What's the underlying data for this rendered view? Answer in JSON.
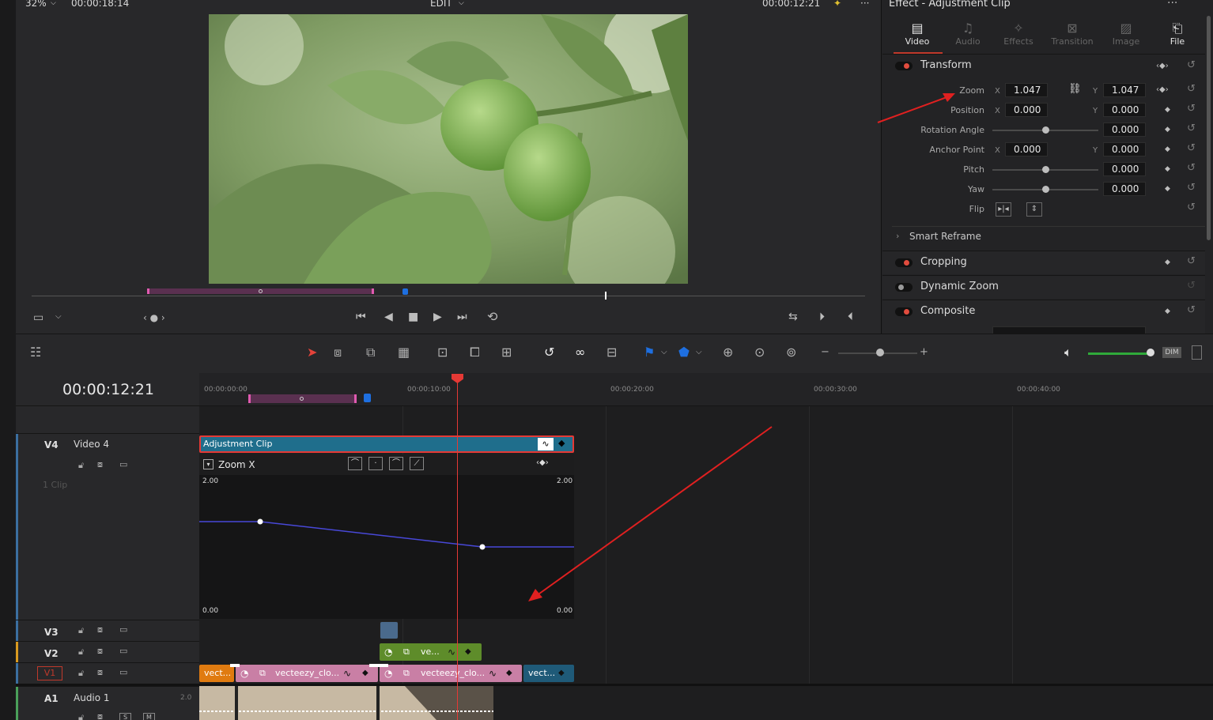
{
  "viewer": {
    "zoom": "32%",
    "source_timecode": "00:00:18:14",
    "mode": "EDIT",
    "record_timecode": "00:00:12:21"
  },
  "inspector": {
    "title": "Effect - Adjustment Clip",
    "tabs": [
      {
        "label": "Video",
        "icon": "film-icon",
        "active": true
      },
      {
        "label": "Audio",
        "icon": "music-note-icon",
        "active": false
      },
      {
        "label": "Effects",
        "icon": "magic-wand-icon",
        "active": false
      },
      {
        "label": "Transition",
        "icon": "transition-icon",
        "active": false
      },
      {
        "label": "Image",
        "icon": "image-icon",
        "active": false
      },
      {
        "label": "File",
        "icon": "file-icon",
        "active": false
      }
    ],
    "transform": {
      "label": "Transform",
      "zoom": {
        "label": "Zoom",
        "x_axis": "X",
        "y_axis": "Y",
        "x": "1.047",
        "y": "1.047"
      },
      "position": {
        "label": "Position",
        "x": "0.000",
        "y": "0.000"
      },
      "rotation": {
        "label": "Rotation Angle",
        "value": "0.000"
      },
      "anchor": {
        "label": "Anchor Point",
        "x": "0.000",
        "y": "0.000"
      },
      "pitch": {
        "label": "Pitch",
        "value": "0.000"
      },
      "yaw": {
        "label": "Yaw",
        "value": "0.000"
      },
      "flip": {
        "label": "Flip"
      }
    },
    "smart_reframe": "Smart Reframe",
    "cropping": "Cropping",
    "dynamic_zoom": "Dynamic Zoom",
    "composite": "Composite"
  },
  "timeline": {
    "timecode": "00:00:12:21",
    "ruler": [
      "00:00:00:00",
      "00:00:10:00",
      "00:00:20:00",
      "00:00:30:00",
      "00:00:40:00"
    ],
    "tracks": {
      "v4": {
        "id": "V4",
        "name": "Video 4",
        "clip_count": "1 Clip"
      },
      "v3": {
        "id": "V3"
      },
      "v2": {
        "id": "V2"
      },
      "v1": {
        "id": "V1"
      },
      "a1": {
        "id": "A1",
        "name": "Audio 1",
        "channels": "2.0",
        "s": "S",
        "m": "M"
      }
    },
    "adjustment_clip": "Adjustment Clip",
    "curve": {
      "label": "Zoom X",
      "max_left": "2.00",
      "max_right": "2.00",
      "min_left": "0.00",
      "min_right": "0.00"
    },
    "clips": {
      "v2": "ve...",
      "v1a": "vect...",
      "v1b": "vecteezy_clo...",
      "v1c": "vecteezy_clo...",
      "v1d": "vect..."
    },
    "dim": "DIM"
  },
  "colors": {
    "accent": "#e53935",
    "adjustment_clip": "#1f6e8c",
    "video_clip_pink": "#c97fa5",
    "video_clip_green": "#5e8c2a",
    "video_clip_orange": "#e07b10",
    "audio_clip": "#c7b9a3",
    "curve_line": "#4848d8"
  }
}
